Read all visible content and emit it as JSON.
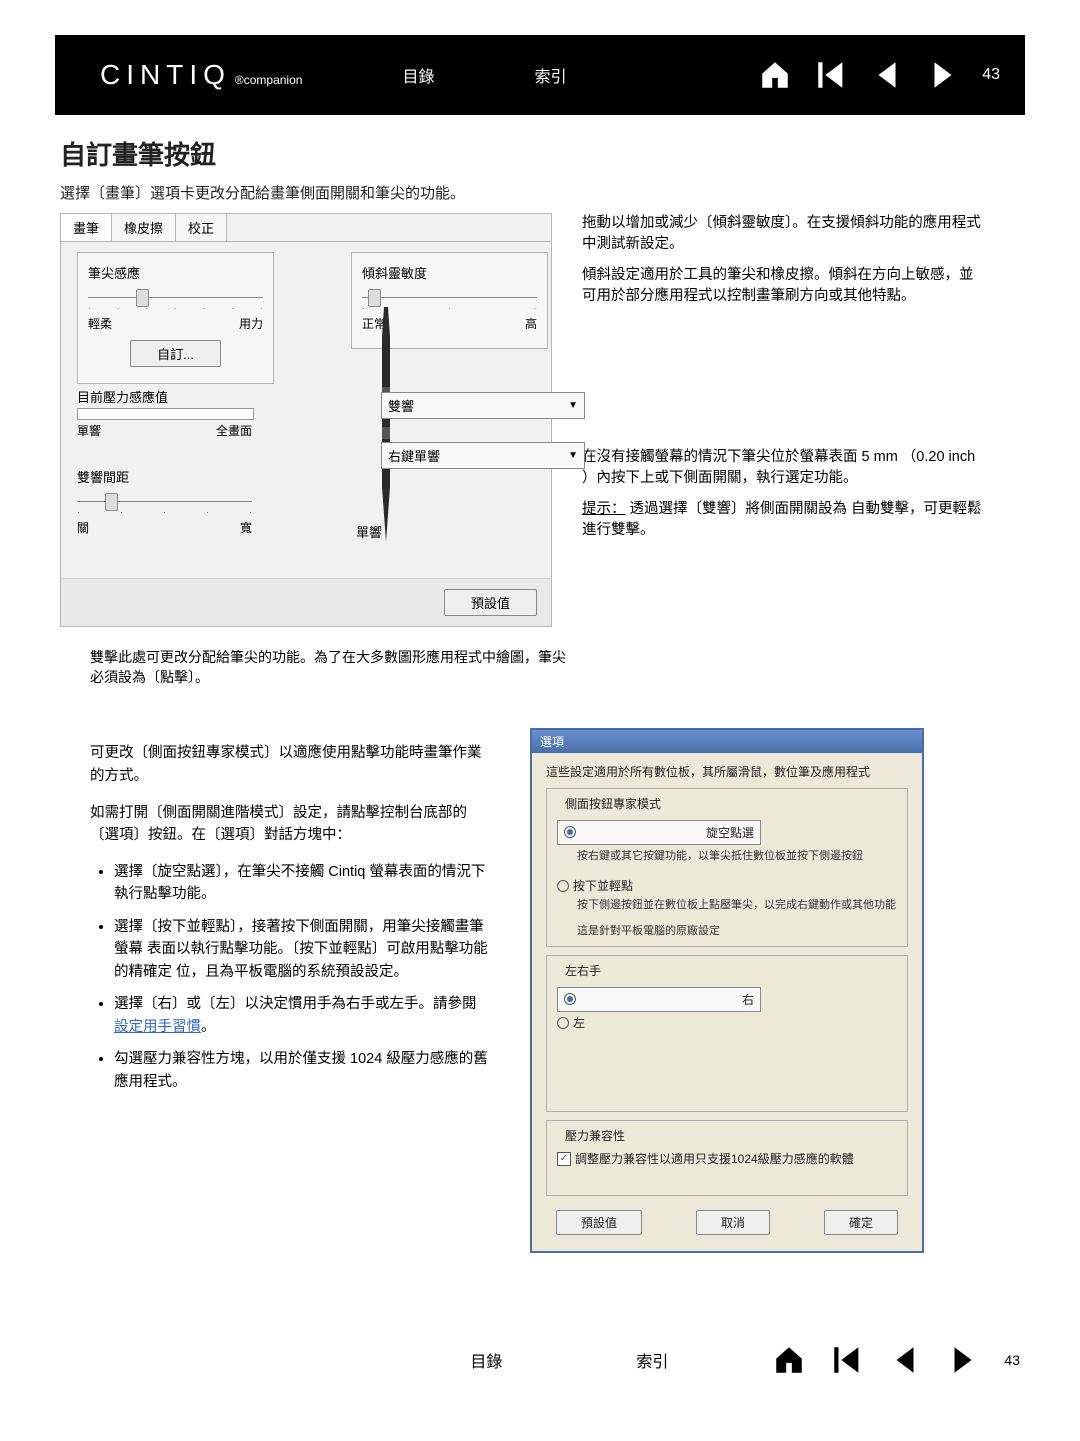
{
  "header": {
    "logo_main": "CINTIQ",
    "logo_sub": "®companion",
    "nav": {
      "toc": "目錄",
      "index": "索引"
    },
    "pageno": "43"
  },
  "title": "自訂畫筆按鈕",
  "sub": "選擇〔畫筆〕選項卡更改分配給畫筆側面開關和筆尖的功能。",
  "panel": {
    "tabs": [
      "畫筆",
      "橡皮擦",
      "校正"
    ],
    "tip_feel_title": "筆尖感應",
    "tip_soft": "輕柔",
    "tip_firm": "用力",
    "custom_btn": "自訂...",
    "current_pressure": "目前壓力感應值",
    "click": "單響",
    "full": "全畫面",
    "dblclick_dist": "雙響間距",
    "off": "關",
    "wide": "寬",
    "tilt_title": "傾斜靈敏度",
    "tilt_norm": "正常",
    "tilt_high": "高",
    "dd_upper": "雙響",
    "dd_lower": "右鍵單響",
    "eraser_label": "單響",
    "default_btn": "預設值"
  },
  "right": {
    "p1": "拖動以增加或減少〔傾斜靈敏度〕。在支援傾斜功能的應用程式中測試新設定。",
    "p2": "傾斜設定適用於工具的筆尖和橡皮擦。傾斜在方向上敏感，並可用於部分應用程式以控制畫筆刷方向或其他特點。",
    "p3": "在沒有接觸螢幕的情況下筆尖位於螢幕表面 5 mm （0.20 inch ）內按下上或下側面開關，執行選定功能。",
    "p4a": "提示：",
    "p4b": "透過選擇〔雙響〕將側面開關設為 自動雙擊，可更輕鬆進行雙擊。"
  },
  "midnote": "雙擊此處可更改分配給筆尖的功能。為了在大多數圖形應用程式中繪圖，筆尖必須設為〔點擊〕。",
  "lower": {
    "p1": "可更改〔側面按鈕專家模式〕以適應使用點擊功能時畫筆作業的方式。",
    "p2": "如需打開〔側面開關進階模式〕設定，請點擊控制台底部的〔選項〕按鈕。在〔選項〕對話方塊中：",
    "b1": "選擇〔旋空點選〕，在筆尖不接觸 Cintiq 螢幕表面的情況下執行點擊功能。",
    "b2": "選擇〔按下並輕點〕，接著按下側面開關，用筆尖接觸畫筆螢幕 表面以執行點擊功能。〔按下並輕點〕可啟用點擊功能的精確定 位，且為平板電腦的系統預設設定。",
    "b3a": "選擇〔右〕或〔左〕以決定慣用手為右手或左手。請參閱",
    "b3link": "設定用手習慣",
    "b3b": "。",
    "b4": "勾選壓力兼容性方塊，以用於僅支援 1024 級壓力感應的舊應用程式。"
  },
  "dialog": {
    "title": "選項",
    "desc": "這些設定適用於所有數位板，其所屬滑鼠，數位筆及應用程式",
    "grp1_title": "側面按鈕專家模式",
    "r1": "旋空點選",
    "r1_sub": "按右鍵或其它按鍵功能，以筆尖抵住數位板並按下側邊按鈕",
    "r2": "按下並輕點",
    "r2_sub": "按下側邊按鈕並在數位板上點壓筆尖，以完成右鍵動作或其他功能",
    "r2_note": "這是針對平板電腦的原廠設定",
    "grp2_title": "左右手",
    "r3": "右",
    "r4": "左",
    "grp3_title": "壓力兼容性",
    "cb": "調整壓力兼容性以適用只支援1024級壓力感應的軟體",
    "btn_default": "預設值",
    "btn_cancel": "取消",
    "btn_ok": "確定"
  },
  "footer": {
    "toc": "目錄",
    "index": "索引",
    "pageno": "43"
  }
}
